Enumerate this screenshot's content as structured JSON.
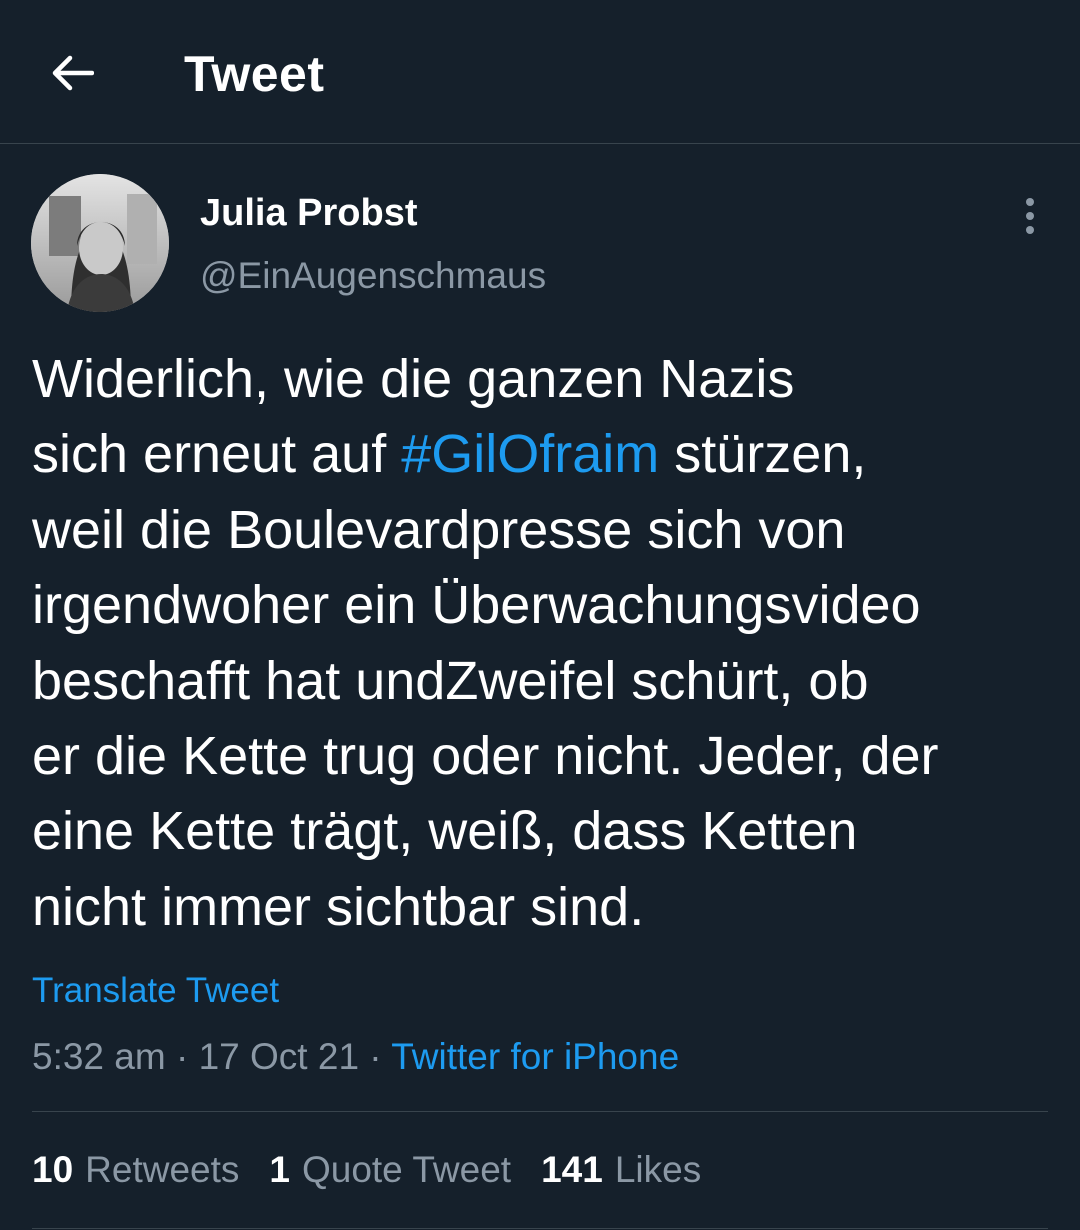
{
  "header": {
    "back_icon": "arrow-left-icon",
    "title": "Tweet"
  },
  "tweet": {
    "author": {
      "display_name": "Julia Probst",
      "handle": "@EinAugenschmaus",
      "avatar": "profile-photo"
    },
    "more_icon": "vertical-ellipsis-icon",
    "text_before": "Widerlich, wie die ganzen Nazis\nsich erneut auf ",
    "hashtag": "#GilOfraim",
    "text_after": " stürzen,\nweil die Boulevardpresse sich von\nirgendwoher ein Überwachungsvideo\nbeschafft hat undZweifel schürt, ob\ner die Kette trug oder nicht. Jeder, der\neine Kette trägt, weiß, dass Ketten\nnicht immer sichtbar sind.",
    "translate_label": "Translate Tweet",
    "time": "5:32 am",
    "separator": " · ",
    "date": "17 Oct 21",
    "source": "Twitter for iPhone"
  },
  "stats": {
    "retweets_count": "10",
    "retweets_label": "Retweets",
    "quotes_count": "1",
    "quotes_label": "Quote Tweet",
    "likes_count": "141",
    "likes_label": "Likes"
  },
  "colors": {
    "background": "#15202b",
    "accent": "#1d9bf0",
    "secondary_text": "#8b98a5",
    "divider": "#38444d"
  }
}
